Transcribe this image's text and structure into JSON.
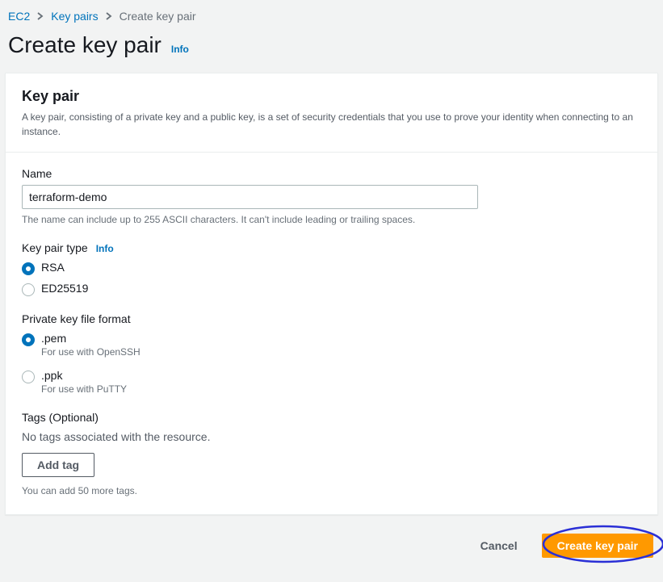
{
  "breadcrumb": {
    "items": [
      {
        "label": "EC2",
        "link": true
      },
      {
        "label": "Key pairs",
        "link": true
      },
      {
        "label": "Create key pair",
        "link": false
      }
    ]
  },
  "page": {
    "title": "Create key pair",
    "info": "Info"
  },
  "panel": {
    "title": "Key pair",
    "description": "A key pair, consisting of a private key and a public key, is a set of security credentials that you use to prove your identity when connecting to an instance."
  },
  "form": {
    "name": {
      "label": "Name",
      "value": "terraform-demo",
      "hint": "The name can include up to 255 ASCII characters. It can't include leading or trailing spaces."
    },
    "type": {
      "label": "Key pair type",
      "info": "Info",
      "options": [
        {
          "label": "RSA",
          "checked": true
        },
        {
          "label": "ED25519",
          "checked": false
        }
      ]
    },
    "format": {
      "label": "Private key file format",
      "options": [
        {
          "label": ".pem",
          "sub": "For use with OpenSSH",
          "checked": true
        },
        {
          "label": ".ppk",
          "sub": "For use with PuTTY",
          "checked": false
        }
      ]
    },
    "tags": {
      "label": "Tags (Optional)",
      "text": "No tags associated with the resource.",
      "add_button": "Add tag",
      "hint": "You can add 50 more tags."
    }
  },
  "actions": {
    "cancel": "Cancel",
    "create": "Create key pair"
  }
}
